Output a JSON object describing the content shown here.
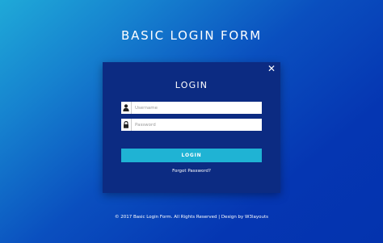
{
  "page": {
    "title": "BASIC LOGIN FORM",
    "footer": "© 2017 Basic Login Form. All Rights Reserved | Design by W3layouts"
  },
  "card": {
    "close_icon": "close-icon",
    "title": "LOGIN",
    "username": {
      "placeholder": "Username",
      "value": "",
      "icon": "user-icon"
    },
    "password": {
      "placeholder": "Password",
      "value": "",
      "icon": "lock-icon"
    },
    "login_button": "LOGIN",
    "forgot_link": "Forgot Password?"
  },
  "colors": {
    "background_start": "#1fa9d8",
    "background_end": "#0433ae",
    "card": "#0c2b82",
    "button": "#1fb3d4",
    "text": "#ffffff"
  }
}
